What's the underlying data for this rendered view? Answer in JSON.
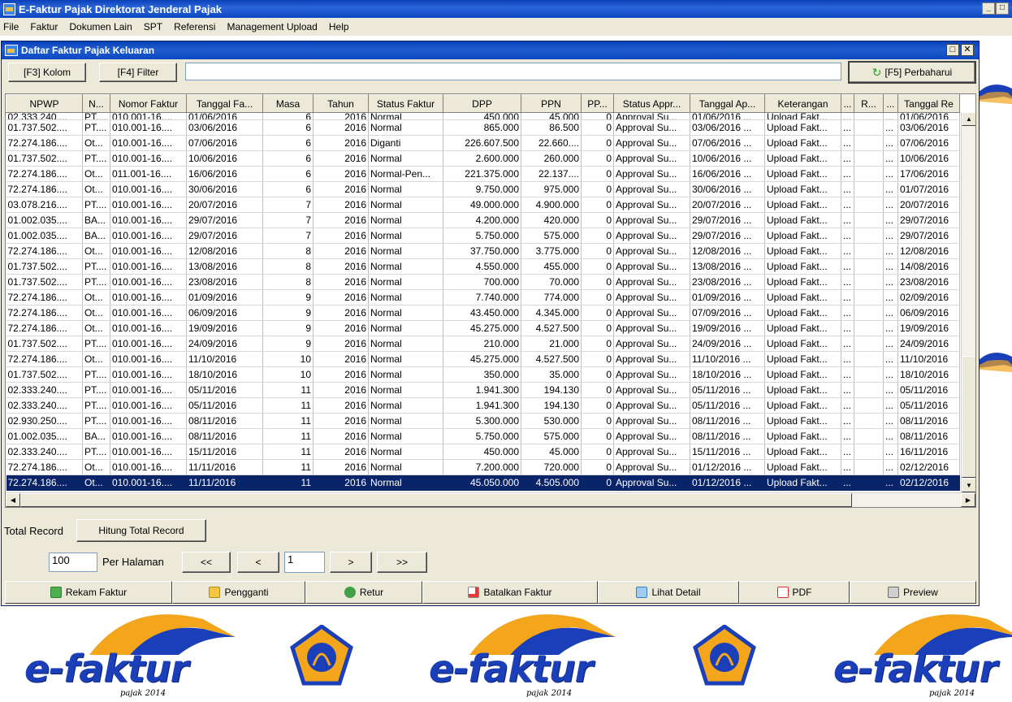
{
  "app": {
    "title": "E-Faktur Pajak Direktorat Jenderal Pajak",
    "ctrl_min": "_",
    "ctrl_max": "□"
  },
  "menu": [
    "File",
    "Faktur",
    "Dokumen Lain",
    "SPT",
    "Referensi",
    "Management Upload",
    "Help"
  ],
  "window": {
    "title": "Daftar Faktur Pajak Keluaran",
    "ctrl_restore": "□",
    "ctrl_close": "✕"
  },
  "toolbar": {
    "kolom": "[F3] Kolom",
    "filter": "[F4] Filter",
    "filter_value": "",
    "refresh": "[F5] Perbaharui"
  },
  "table": {
    "columns": [
      "NPWP",
      "N...",
      "Nomor Faktur",
      "Tanggal Fa...",
      "Masa",
      "Tahun",
      "Status Faktur",
      "DPP",
      "PPN",
      "PP...",
      "Status Appr...",
      "Tanggal Ap...",
      "Keterangan",
      "...",
      "R...",
      "...",
      "Tanggal Re"
    ],
    "partial_row": [
      "02.333.240....",
      "PT....",
      "010.001-16....",
      "01/06/2016",
      "6",
      "2016",
      "Normal",
      "450.000",
      "45.000",
      "0",
      "Approval Su...",
      "01/06/2016 ...",
      "Upload Fakt...",
      "...",
      "",
      "...",
      "01/06/2016"
    ],
    "rows": [
      [
        "01.737.502....",
        "PT....",
        "010.001-16....",
        "03/06/2016",
        "6",
        "2016",
        "Normal",
        "865.000",
        "86.500",
        "0",
        "Approval Su...",
        "03/06/2016 ...",
        "Upload Fakt...",
        "...",
        "",
        "...",
        "03/06/2016"
      ],
      [
        "72.274.186....",
        "Ot...",
        "010.001-16....",
        "07/06/2016",
        "6",
        "2016",
        "Diganti",
        "226.607.500",
        "22.660....",
        "0",
        "Approval Su...",
        "07/06/2016 ...",
        "Upload Fakt...",
        "...",
        "",
        "...",
        "07/06/2016"
      ],
      [
        "01.737.502....",
        "PT....",
        "010.001-16....",
        "10/06/2016",
        "6",
        "2016",
        "Normal",
        "2.600.000",
        "260.000",
        "0",
        "Approval Su...",
        "10/06/2016 ...",
        "Upload Fakt...",
        "...",
        "",
        "...",
        "10/06/2016"
      ],
      [
        "72.274.186....",
        "Ot...",
        "011.001-16....",
        "16/06/2016",
        "6",
        "2016",
        "Normal-Pen...",
        "221.375.000",
        "22.137....",
        "0",
        "Approval Su...",
        "16/06/2016 ...",
        "Upload Fakt...",
        "...",
        "",
        "...",
        "17/06/2016"
      ],
      [
        "72.274.186....",
        "Ot...",
        "010.001-16....",
        "30/06/2016",
        "6",
        "2016",
        "Normal",
        "9.750.000",
        "975.000",
        "0",
        "Approval Su...",
        "30/06/2016 ...",
        "Upload Fakt...",
        "...",
        "",
        "...",
        "01/07/2016"
      ],
      [
        "03.078.216....",
        "PT....",
        "010.001-16....",
        "20/07/2016",
        "7",
        "2016",
        "Normal",
        "49.000.000",
        "4.900.000",
        "0",
        "Approval Su...",
        "20/07/2016 ...",
        "Upload Fakt...",
        "...",
        "",
        "...",
        "20/07/2016"
      ],
      [
        "01.002.035....",
        "BA...",
        "010.001-16....",
        "29/07/2016",
        "7",
        "2016",
        "Normal",
        "4.200.000",
        "420.000",
        "0",
        "Approval Su...",
        "29/07/2016 ...",
        "Upload Fakt...",
        "...",
        "",
        "...",
        "29/07/2016"
      ],
      [
        "01.002.035....",
        "BA...",
        "010.001-16....",
        "29/07/2016",
        "7",
        "2016",
        "Normal",
        "5.750.000",
        "575.000",
        "0",
        "Approval Su...",
        "29/07/2016 ...",
        "Upload Fakt...",
        "...",
        "",
        "...",
        "29/07/2016"
      ],
      [
        "72.274.186....",
        "Ot...",
        "010.001-16....",
        "12/08/2016",
        "8",
        "2016",
        "Normal",
        "37.750.000",
        "3.775.000",
        "0",
        "Approval Su...",
        "12/08/2016 ...",
        "Upload Fakt...",
        "...",
        "",
        "...",
        "12/08/2016"
      ],
      [
        "01.737.502....",
        "PT....",
        "010.001-16....",
        "13/08/2016",
        "8",
        "2016",
        "Normal",
        "4.550.000",
        "455.000",
        "0",
        "Approval Su...",
        "13/08/2016 ...",
        "Upload Fakt...",
        "...",
        "",
        "...",
        "14/08/2016"
      ],
      [
        "01.737.502....",
        "PT....",
        "010.001-16....",
        "23/08/2016",
        "8",
        "2016",
        "Normal",
        "700.000",
        "70.000",
        "0",
        "Approval Su...",
        "23/08/2016 ...",
        "Upload Fakt...",
        "...",
        "",
        "...",
        "23/08/2016"
      ],
      [
        "72.274.186....",
        "Ot...",
        "010.001-16....",
        "01/09/2016",
        "9",
        "2016",
        "Normal",
        "7.740.000",
        "774.000",
        "0",
        "Approval Su...",
        "01/09/2016 ...",
        "Upload Fakt...",
        "...",
        "",
        "...",
        "02/09/2016"
      ],
      [
        "72.274.186....",
        "Ot...",
        "010.001-16....",
        "06/09/2016",
        "9",
        "2016",
        "Normal",
        "43.450.000",
        "4.345.000",
        "0",
        "Approval Su...",
        "07/09/2016 ...",
        "Upload Fakt...",
        "...",
        "",
        "...",
        "06/09/2016"
      ],
      [
        "72.274.186....",
        "Ot...",
        "010.001-16....",
        "19/09/2016",
        "9",
        "2016",
        "Normal",
        "45.275.000",
        "4.527.500",
        "0",
        "Approval Su...",
        "19/09/2016 ...",
        "Upload Fakt...",
        "...",
        "",
        "...",
        "19/09/2016"
      ],
      [
        "01.737.502....",
        "PT....",
        "010.001-16....",
        "24/09/2016",
        "9",
        "2016",
        "Normal",
        "210.000",
        "21.000",
        "0",
        "Approval Su...",
        "24/09/2016 ...",
        "Upload Fakt...",
        "...",
        "",
        "...",
        "24/09/2016"
      ],
      [
        "72.274.186....",
        "Ot...",
        "010.001-16....",
        "11/10/2016",
        "10",
        "2016",
        "Normal",
        "45.275.000",
        "4.527.500",
        "0",
        "Approval Su...",
        "11/10/2016 ...",
        "Upload Fakt...",
        "...",
        "",
        "...",
        "11/10/2016"
      ],
      [
        "01.737.502....",
        "PT....",
        "010.001-16....",
        "18/10/2016",
        "10",
        "2016",
        "Normal",
        "350.000",
        "35.000",
        "0",
        "Approval Su...",
        "18/10/2016 ...",
        "Upload Fakt...",
        "...",
        "",
        "...",
        "18/10/2016"
      ],
      [
        "02.333.240....",
        "PT....",
        "010.001-16....",
        "05/11/2016",
        "11",
        "2016",
        "Normal",
        "1.941.300",
        "194.130",
        "0",
        "Approval Su...",
        "05/11/2016 ...",
        "Upload Fakt...",
        "...",
        "",
        "...",
        "05/11/2016"
      ],
      [
        "02.333.240....",
        "PT....",
        "010.001-16....",
        "05/11/2016",
        "11",
        "2016",
        "Normal",
        "1.941.300",
        "194.130",
        "0",
        "Approval Su...",
        "05/11/2016 ...",
        "Upload Fakt...",
        "...",
        "",
        "...",
        "05/11/2016"
      ],
      [
        "02.930.250....",
        "PT....",
        "010.001-16....",
        "08/11/2016",
        "11",
        "2016",
        "Normal",
        "5.300.000",
        "530.000",
        "0",
        "Approval Su...",
        "08/11/2016 ...",
        "Upload Fakt...",
        "...",
        "",
        "...",
        "08/11/2016"
      ],
      [
        "01.002.035....",
        "BA...",
        "010.001-16....",
        "08/11/2016",
        "11",
        "2016",
        "Normal",
        "5.750.000",
        "575.000",
        "0",
        "Approval Su...",
        "08/11/2016 ...",
        "Upload Fakt...",
        "...",
        "",
        "...",
        "08/11/2016"
      ],
      [
        "02.333.240....",
        "PT....",
        "010.001-16....",
        "15/11/2016",
        "11",
        "2016",
        "Normal",
        "450.000",
        "45.000",
        "0",
        "Approval Su...",
        "15/11/2016 ...",
        "Upload Fakt...",
        "...",
        "",
        "...",
        "16/11/2016"
      ],
      [
        "72.274.186....",
        "Ot...",
        "010.001-16....",
        "11/11/2016",
        "11",
        "2016",
        "Normal",
        "7.200.000",
        "720.000",
        "0",
        "Approval Su...",
        "01/12/2016 ...",
        "Upload Fakt...",
        "...",
        "",
        "...",
        "02/12/2016"
      ],
      [
        "72.274.186....",
        "Ot...",
        "010.001-16....",
        "11/11/2016",
        "11",
        "2016",
        "Normal",
        "45.050.000",
        "4.505.000",
        "0",
        "Approval Su...",
        "01/12/2016 ...",
        "Upload Fakt...",
        "...",
        "",
        "...",
        "02/12/2016"
      ]
    ],
    "selected_index": 23
  },
  "record": {
    "label": "Total Record",
    "button": "Hitung Total Record"
  },
  "paging": {
    "per_page_value": "100",
    "per_page_label": "Per Halaman",
    "first": "<<",
    "prev": "<",
    "page_value": "1",
    "next": ">",
    "last": ">>"
  },
  "actions": [
    "Rekam Faktur",
    "Pengganti",
    "Retur",
    "Batalkan Faktur",
    "Lihat Detail",
    "PDF",
    "Preview"
  ],
  "logo": {
    "text": "e-faktur",
    "sub": "pajak 2014"
  },
  "colors": {
    "title_blue": "#0c47c4",
    "selection": "#0a246a",
    "logo_blue": "#1b3fb8",
    "logo_orange": "#f3a51c"
  },
  "icons": {
    "refresh": "refresh-icon",
    "emblem": "kemenkeu-emblem-icon"
  }
}
